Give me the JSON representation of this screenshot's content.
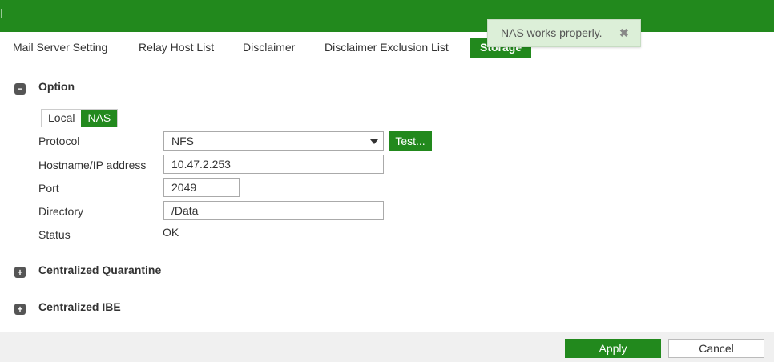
{
  "header": {
    "title": "I"
  },
  "tabs": [
    "Mail Server Setting",
    "Relay Host List",
    "Disclaimer",
    "Disclaimer Exclusion List",
    "Storage"
  ],
  "toast": {
    "message": "NAS works properly.",
    "close": "✖"
  },
  "option": {
    "title": "Option",
    "icon": "minus-icon",
    "toggle": {
      "local": "Local",
      "nas": "NAS",
      "selected": "NAS"
    },
    "fields": {
      "protocol_label": "Protocol",
      "protocol_value": "NFS",
      "test_label": "Test...",
      "host_label": "Hostname/IP address",
      "host_value": "10.47.2.253",
      "port_label": "Port",
      "port_value": "2049",
      "dir_label": "Directory",
      "dir_value": "/Data",
      "status_label": "Status",
      "status_value": "OK"
    }
  },
  "sections": {
    "quarantine": "Centralized Quarantine",
    "ibe": "Centralized IBE"
  },
  "footer": {
    "apply": "Apply",
    "cancel": "Cancel"
  },
  "colors": {
    "accent": "#22891d"
  }
}
